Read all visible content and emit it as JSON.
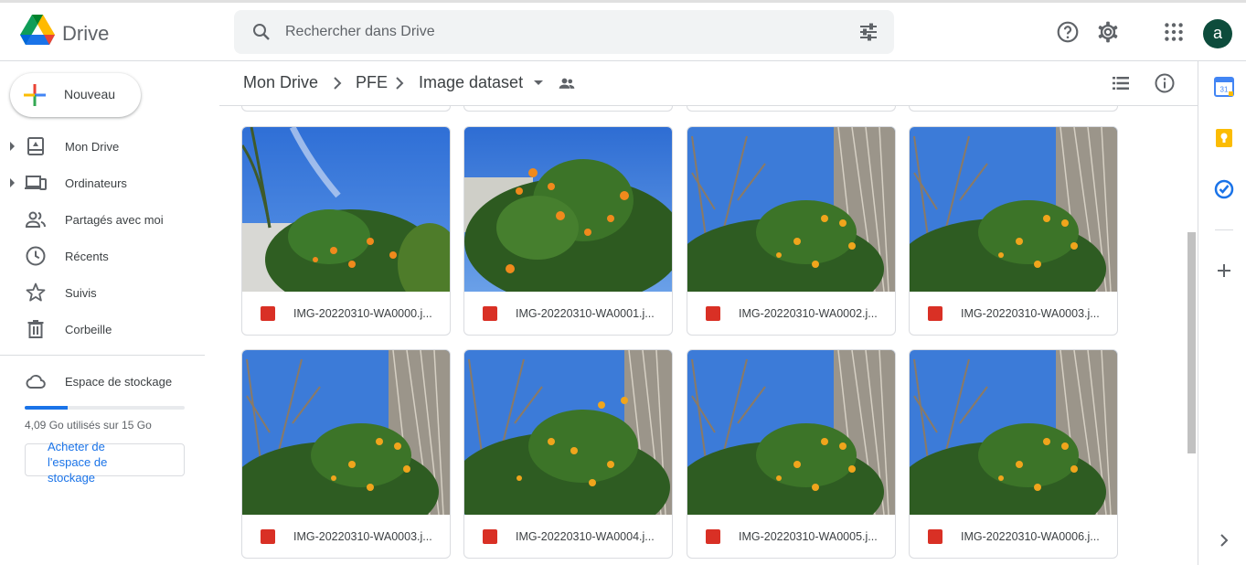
{
  "header": {
    "app_name": "Drive",
    "search_placeholder": "Rechercher dans Drive",
    "help_icon": "help-icon",
    "settings_icon": "gear-icon",
    "apps_icon": "apps-grid-icon",
    "avatar_letter": "a",
    "avatar_color": "#0d4c3c"
  },
  "sidebar": {
    "new_label": "Nouveau",
    "items": [
      {
        "label": "Mon Drive",
        "icon": "my-drive-icon",
        "expandable": true
      },
      {
        "label": "Ordinateurs",
        "icon": "computers-icon",
        "expandable": true
      },
      {
        "label": "Partagés avec moi",
        "icon": "shared-icon",
        "expandable": false
      },
      {
        "label": "Récents",
        "icon": "clock-icon",
        "expandable": false
      },
      {
        "label": "Suivis",
        "icon": "star-icon",
        "expandable": false
      },
      {
        "label": "Corbeille",
        "icon": "trash-icon",
        "expandable": false
      }
    ],
    "storage": {
      "title": "Espace de stockage",
      "used_text": "4,09 Go utilisés sur 15 Go",
      "used_fraction": 0.27,
      "buy_label": "Acheter de l'espace de stockage"
    }
  },
  "toolbar": {
    "breadcrumb": [
      "Mon Drive",
      "PFE",
      "Image dataset"
    ],
    "list_view_icon": "list-view-icon",
    "info_icon": "info-icon"
  },
  "files": [
    {
      "name": "IMG-20220310-WA0000.j..."
    },
    {
      "name": "IMG-20220310-WA0001.j..."
    },
    {
      "name": "IMG-20220310-WA0002.j..."
    },
    {
      "name": "IMG-20220310-WA0003.j..."
    },
    {
      "name": "IMG-20220310-WA0003.j..."
    },
    {
      "name": "IMG-20220310-WA0004.j..."
    },
    {
      "name": "IMG-20220310-WA0005.j..."
    },
    {
      "name": "IMG-20220310-WA0006.j..."
    }
  ],
  "side_panel": {
    "calendar_day": "31",
    "icons": [
      "calendar-icon",
      "keep-icon",
      "tasks-icon",
      "add-icon",
      "chevron-right-icon"
    ]
  },
  "colors": {
    "accent": "#1a73e8",
    "file_icon": "#d93025"
  }
}
